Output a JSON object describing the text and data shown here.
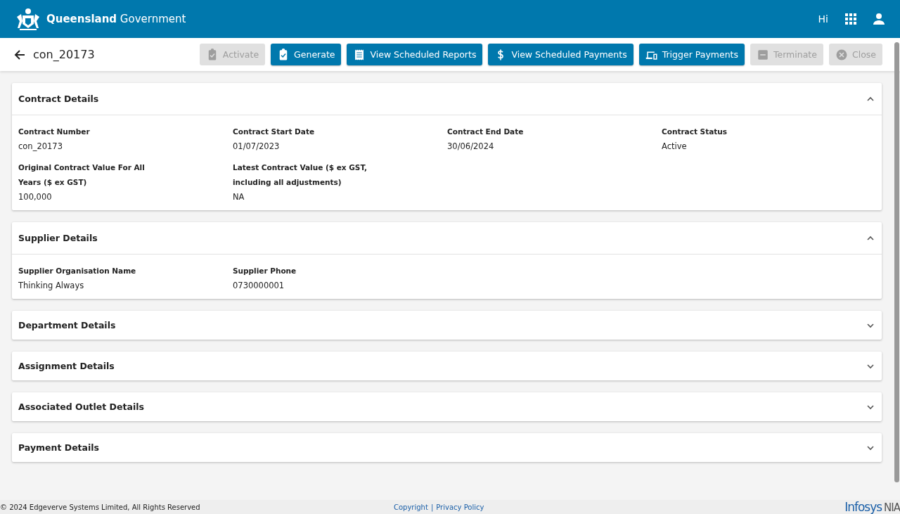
{
  "header": {
    "brand_bold": "Queensland",
    "brand_rest": "Government",
    "greeting": "Hi"
  },
  "toolbar": {
    "back_title": "con_20173",
    "buttons": [
      {
        "label": "Activate",
        "kind": "clipboard-check",
        "disabled": true
      },
      {
        "label": "Generate",
        "kind": "clipboard-check",
        "disabled": false
      },
      {
        "label": "View Scheduled Reports",
        "kind": "receipt",
        "disabled": false
      },
      {
        "label": "View Scheduled Payments",
        "kind": "dollar",
        "disabled": false
      },
      {
        "label": "Trigger Payments",
        "kind": "devices",
        "disabled": false
      },
      {
        "label": "Terminate",
        "kind": "minus",
        "disabled": true
      },
      {
        "label": "Close",
        "kind": "cancel",
        "disabled": true
      }
    ]
  },
  "sections": [
    {
      "title": "Contract Details",
      "expanded": true,
      "fields": [
        {
          "label": "Contract Number",
          "value": "con_20173"
        },
        {
          "label": "Contract Start Date",
          "value": "01/07/2023"
        },
        {
          "label": "Contract End Date",
          "value": "30/06/2024"
        },
        {
          "label": "Contract Status",
          "value": "Active"
        },
        {
          "label": "Original Contract Value For All Years ($ ex GST)",
          "value": "100,000"
        },
        {
          "label": "Latest Contract Value ($ ex GST, including all adjustments)",
          "value": "NA"
        }
      ]
    },
    {
      "title": "Supplier Details",
      "expanded": true,
      "fields": [
        {
          "label": "Supplier Organisation Name",
          "value": "Thinking Always"
        },
        {
          "label": "Supplier Phone",
          "value": "0730000001"
        }
      ]
    },
    {
      "title": "Department Details",
      "expanded": false
    },
    {
      "title": "Assignment Details",
      "expanded": false
    },
    {
      "title": "Associated Outlet Details",
      "expanded": false
    },
    {
      "title": "Payment Details",
      "expanded": false
    }
  ],
  "footer": {
    "copyright": "© 2024 Edgeverve Systems Limited, All Rights Reserved",
    "links": [
      "Copyright",
      "Privacy Policy"
    ],
    "separator": "|",
    "logo_main": "Infosys",
    "logo_suffix": "NIA"
  }
}
